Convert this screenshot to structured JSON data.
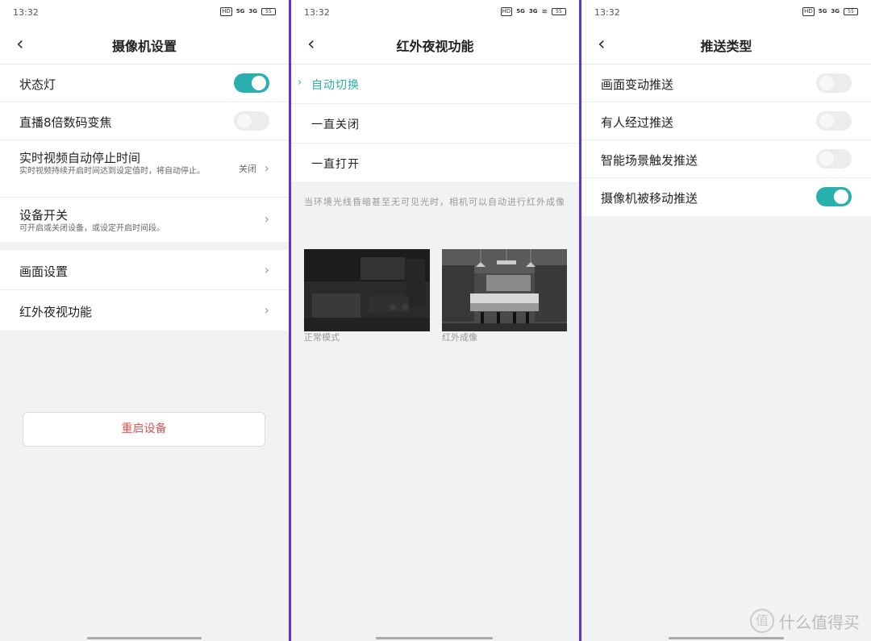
{
  "status": {
    "time": "13:32",
    "hd": "HD",
    "sig1": "5G",
    "sig2": "3G",
    "battery": "55"
  },
  "panel1": {
    "title": "摄像机设置",
    "rows": [
      {
        "label": "状态灯",
        "toggle": true
      },
      {
        "label": "直播8倍数码变焦",
        "toggle": false
      },
      {
        "label": "实时视频自动停止时间",
        "sub": "实时视频持续开启时间达到设定值时，将自动停止。",
        "value": "关闭"
      },
      {
        "label": "设备开关",
        "sub": "可开启或关闭设备，或设定开启时间段。"
      },
      {
        "label": "画面设置"
      },
      {
        "label": "红外夜视功能"
      }
    ],
    "restart_label": "重启设备"
  },
  "panel2": {
    "title": "红外夜视功能",
    "options": [
      "自动切换",
      "一直关闭",
      "一直打开"
    ],
    "selected": "自动切换",
    "description": "当环境光线昏暗甚至无可见光时，相机可以自动进行红外成像",
    "photos": [
      {
        "caption": "正常模式"
      },
      {
        "caption": "红外成像"
      }
    ]
  },
  "panel3": {
    "title": "推送类型",
    "rows": [
      {
        "label": "画面变动推送",
        "toggle": false
      },
      {
        "label": "有人经过推送",
        "toggle": false
      },
      {
        "label": "智能场景触发推送",
        "toggle": false
      },
      {
        "label": "摄像机被移动推送",
        "toggle": true
      }
    ]
  },
  "watermark": {
    "logo": "值",
    "text": "什么值得买"
  },
  "colors": {
    "accent": "#27b0ae",
    "divider": "#5b35d6",
    "danger": "#e05555"
  }
}
